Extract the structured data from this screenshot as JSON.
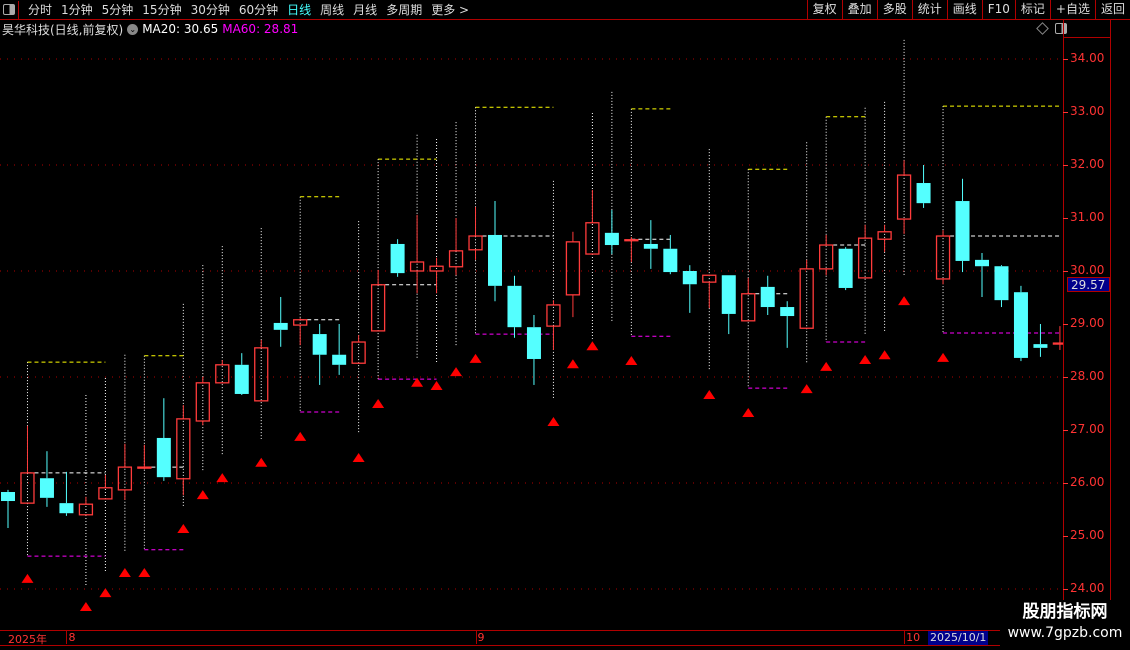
{
  "toolbar": {
    "periods": [
      "分时",
      "1分钟",
      "5分钟",
      "15分钟",
      "30分钟",
      "60分钟",
      "日线",
      "周线",
      "月线",
      "多周期",
      "更多 >"
    ],
    "active_period": "日线",
    "buttons": [
      "复权",
      "叠加",
      "多股",
      "统计",
      "画线",
      "F10",
      "标记",
      "+自选",
      "返回"
    ]
  },
  "info": {
    "title": "昊华科技(日线,前复权)",
    "ma20": "MA20: 30.65",
    "ma60": "MA60: 28.81"
  },
  "axis": {
    "price_labels": [
      "34.00",
      "33.00",
      "32.00",
      "31.00",
      "30.00",
      "29.00",
      "28.00",
      "27.00",
      "26.00",
      "25.00",
      "24.00"
    ],
    "current_price": "29.57",
    "x_labels": [
      {
        "text": "2025年",
        "idx": 1
      },
      {
        "text": "8",
        "idx": 4
      },
      {
        "text": "9",
        "idx": 25
      },
      {
        "text": "10",
        "idx": 47
      }
    ],
    "cursor_date": "2025/10/1"
  },
  "watermark": {
    "line1": "股朋指标网",
    "line2": "www.7gpzb.com"
  },
  "colors": {
    "up": "#ff3b3b",
    "down": "#54ffff",
    "box_top": "#ffff00",
    "box_mid": "#ffffff",
    "box_bottom": "#ff00ff",
    "signal": "#ff0000",
    "grid": "#b00000"
  },
  "chart_data": {
    "type": "candlestick",
    "ylim": [
      24,
      34
    ],
    "candles": [
      [
        25.83,
        25.66,
        25.87,
        25.15
      ],
      [
        25.62,
        26.19,
        27.08,
        25.62
      ],
      [
        26.09,
        25.72,
        26.6,
        25.55
      ],
      [
        25.62,
        25.43,
        26.21,
        25.38
      ],
      [
        25.4,
        25.6,
        25.74,
        25.4
      ],
      [
        25.7,
        25.91,
        26.15,
        25.7
      ],
      [
        25.87,
        26.3,
        26.74,
        25.68
      ],
      [
        26.28,
        26.3,
        26.72,
        26.26
      ],
      [
        26.85,
        26.11,
        27.6,
        26.04
      ],
      [
        26.08,
        27.21,
        27.47,
        25.77
      ],
      [
        27.17,
        27.89,
        28.0,
        27.09
      ],
      [
        27.89,
        28.23,
        28.32,
        27.89
      ],
      [
        28.23,
        27.68,
        28.45,
        27.66
      ],
      [
        27.55,
        28.55,
        28.7,
        27.55
      ],
      [
        29.02,
        28.89,
        29.51,
        28.57
      ],
      [
        28.98,
        29.08,
        29.11,
        28.6
      ],
      [
        28.81,
        28.42,
        29.0,
        27.85
      ],
      [
        28.42,
        28.23,
        29.0,
        28.04
      ],
      [
        28.26,
        28.66,
        28.79,
        28.26
      ],
      [
        28.87,
        29.74,
        30.02,
        28.87
      ],
      [
        30.51,
        29.96,
        30.6,
        29.89
      ],
      [
        30.0,
        30.17,
        31.06,
        29.58
      ],
      [
        30.0,
        30.09,
        30.25,
        29.58
      ],
      [
        30.08,
        30.38,
        31.0,
        29.92
      ],
      [
        30.4,
        30.66,
        31.21,
        30.21
      ],
      [
        30.68,
        29.72,
        31.32,
        29.43
      ],
      [
        29.72,
        28.94,
        29.91,
        28.74
      ],
      [
        28.94,
        28.34,
        29.17,
        27.85
      ],
      [
        28.96,
        29.36,
        29.45,
        28.51
      ],
      [
        29.55,
        30.55,
        30.74,
        29.13
      ],
      [
        30.32,
        30.91,
        31.53,
        30.32
      ],
      [
        30.72,
        30.49,
        31.15,
        30.32
      ],
      [
        30.58,
        30.59,
        30.64,
        30.17
      ],
      [
        30.51,
        30.42,
        30.96,
        30.04
      ],
      [
        30.42,
        29.98,
        30.68,
        29.94
      ],
      [
        30.0,
        29.75,
        30.11,
        29.21
      ],
      [
        29.79,
        29.92,
        29.92,
        29.3
      ],
      [
        29.92,
        29.19,
        29.92,
        28.81
      ],
      [
        29.06,
        29.57,
        29.87,
        29.06
      ],
      [
        29.7,
        29.32,
        29.91,
        29.17
      ],
      [
        29.32,
        29.15,
        29.43,
        28.55
      ],
      [
        28.92,
        30.04,
        30.21,
        28.92
      ],
      [
        30.04,
        30.49,
        30.68,
        29.92
      ],
      [
        30.42,
        29.68,
        30.45,
        29.64
      ],
      [
        29.87,
        30.62,
        30.87,
        29.87
      ],
      [
        30.6,
        30.74,
        30.87,
        30.36
      ],
      [
        30.98,
        31.81,
        32.09,
        30.7
      ],
      [
        31.66,
        31.28,
        32.0,
        31.19
      ],
      [
        29.85,
        30.66,
        30.77,
        29.75
      ],
      [
        31.32,
        30.19,
        31.74,
        29.98
      ],
      [
        30.21,
        30.09,
        30.34,
        29.51
      ],
      [
        30.09,
        29.45,
        30.11,
        29.32
      ],
      [
        29.6,
        28.36,
        29.72,
        28.3
      ],
      [
        28.62,
        28.55,
        29.0,
        28.38
      ],
      [
        28.64,
        28.64,
        28.96,
        28.51
      ]
    ],
    "candle_fields": [
      "open",
      "close",
      "high",
      "low"
    ],
    "boxes": [
      {
        "from": 2,
        "to": 6,
        "top": 28.28,
        "mid": 26.19,
        "bottom": 24.62
      },
      {
        "from": 8,
        "to": 10,
        "top": 28.4,
        "mid": 26.3,
        "bottom": 24.74
      },
      {
        "from": 16,
        "to": 18,
        "top": 31.4,
        "mid": 29.08,
        "bottom": 27.34
      },
      {
        "from": 20,
        "to": 23,
        "top": 32.11,
        "mid": 29.74,
        "bottom": 27.96
      },
      {
        "from": 25,
        "to": 29,
        "top": 33.09,
        "mid": 30.66,
        "bottom": 28.81
      },
      {
        "from": 33,
        "to": 35,
        "top": 33.06,
        "mid": 30.6,
        "bottom": 28.77
      },
      {
        "from": 39,
        "to": 41,
        "top": 31.92,
        "mid": 29.57,
        "bottom": 27.79
      },
      {
        "from": 43,
        "to": 45,
        "top": 32.91,
        "mid": 30.49,
        "bottom": 28.66
      },
      {
        "from": 49,
        "to": 55,
        "top": 33.11,
        "mid": 30.66,
        "bottom": 28.83
      }
    ],
    "dotted_ranges": [
      {
        "idx": 5,
        "top": 27.66,
        "bottom": 24.06
      },
      {
        "idx": 6,
        "top": 27.98,
        "bottom": 24.34
      },
      {
        "idx": 7,
        "top": 28.42,
        "bottom": 24.72
      },
      {
        "idx": 10,
        "top": 29.38,
        "bottom": 25.55
      },
      {
        "idx": 11,
        "top": 30.11,
        "bottom": 26.21
      },
      {
        "idx": 12,
        "top": 30.47,
        "bottom": 26.53
      },
      {
        "idx": 14,
        "top": 30.81,
        "bottom": 26.83
      },
      {
        "idx": 19,
        "top": 30.94,
        "bottom": 26.94
      },
      {
        "idx": 22,
        "top": 32.57,
        "bottom": 28.36
      },
      {
        "idx": 23,
        "top": 32.49,
        "bottom": 28.26
      },
      {
        "idx": 24,
        "top": 32.81,
        "bottom": 28.57
      },
      {
        "idx": 29,
        "top": 31.7,
        "bottom": 27.6
      },
      {
        "idx": 31,
        "top": 32.98,
        "bottom": 28.72
      },
      {
        "idx": 32,
        "top": 33.38,
        "bottom": 29.06
      },
      {
        "idx": 37,
        "top": 32.3,
        "bottom": 28.13
      },
      {
        "idx": 42,
        "top": 32.43,
        "bottom": 28.25
      },
      {
        "idx": 45,
        "top": 33.08,
        "bottom": 28.79
      },
      {
        "idx": 46,
        "top": 33.19,
        "bottom": 28.87
      },
      {
        "idx": 47,
        "top": 34.36,
        "bottom": 29.89
      }
    ],
    "signals": [
      {
        "idx": 2,
        "price": 24.21
      },
      {
        "idx": 5,
        "price": 23.68
      },
      {
        "idx": 6,
        "price": 23.94
      },
      {
        "idx": 7,
        "price": 24.32
      },
      {
        "idx": 8,
        "price": 24.32
      },
      {
        "idx": 10,
        "price": 25.15
      },
      {
        "idx": 11,
        "price": 25.79
      },
      {
        "idx": 12,
        "price": 26.11
      },
      {
        "idx": 14,
        "price": 26.4
      },
      {
        "idx": 16,
        "price": 26.89
      },
      {
        "idx": 19,
        "price": 26.49
      },
      {
        "idx": 20,
        "price": 27.51
      },
      {
        "idx": 22,
        "price": 27.91
      },
      {
        "idx": 23,
        "price": 27.85
      },
      {
        "idx": 24,
        "price": 28.11
      },
      {
        "idx": 25,
        "price": 28.36
      },
      {
        "idx": 29,
        "price": 27.17
      },
      {
        "idx": 30,
        "price": 28.26
      },
      {
        "idx": 31,
        "price": 28.6
      },
      {
        "idx": 33,
        "price": 28.32
      },
      {
        "idx": 37,
        "price": 27.68
      },
      {
        "idx": 39,
        "price": 27.34
      },
      {
        "idx": 42,
        "price": 27.79
      },
      {
        "idx": 43,
        "price": 28.21
      },
      {
        "idx": 45,
        "price": 28.34
      },
      {
        "idx": 46,
        "price": 28.43
      },
      {
        "idx": 47,
        "price": 29.45
      },
      {
        "idx": 49,
        "price": 28.38
      }
    ],
    "grid_prices": [
      24,
      26,
      28,
      30,
      32,
      34
    ]
  }
}
